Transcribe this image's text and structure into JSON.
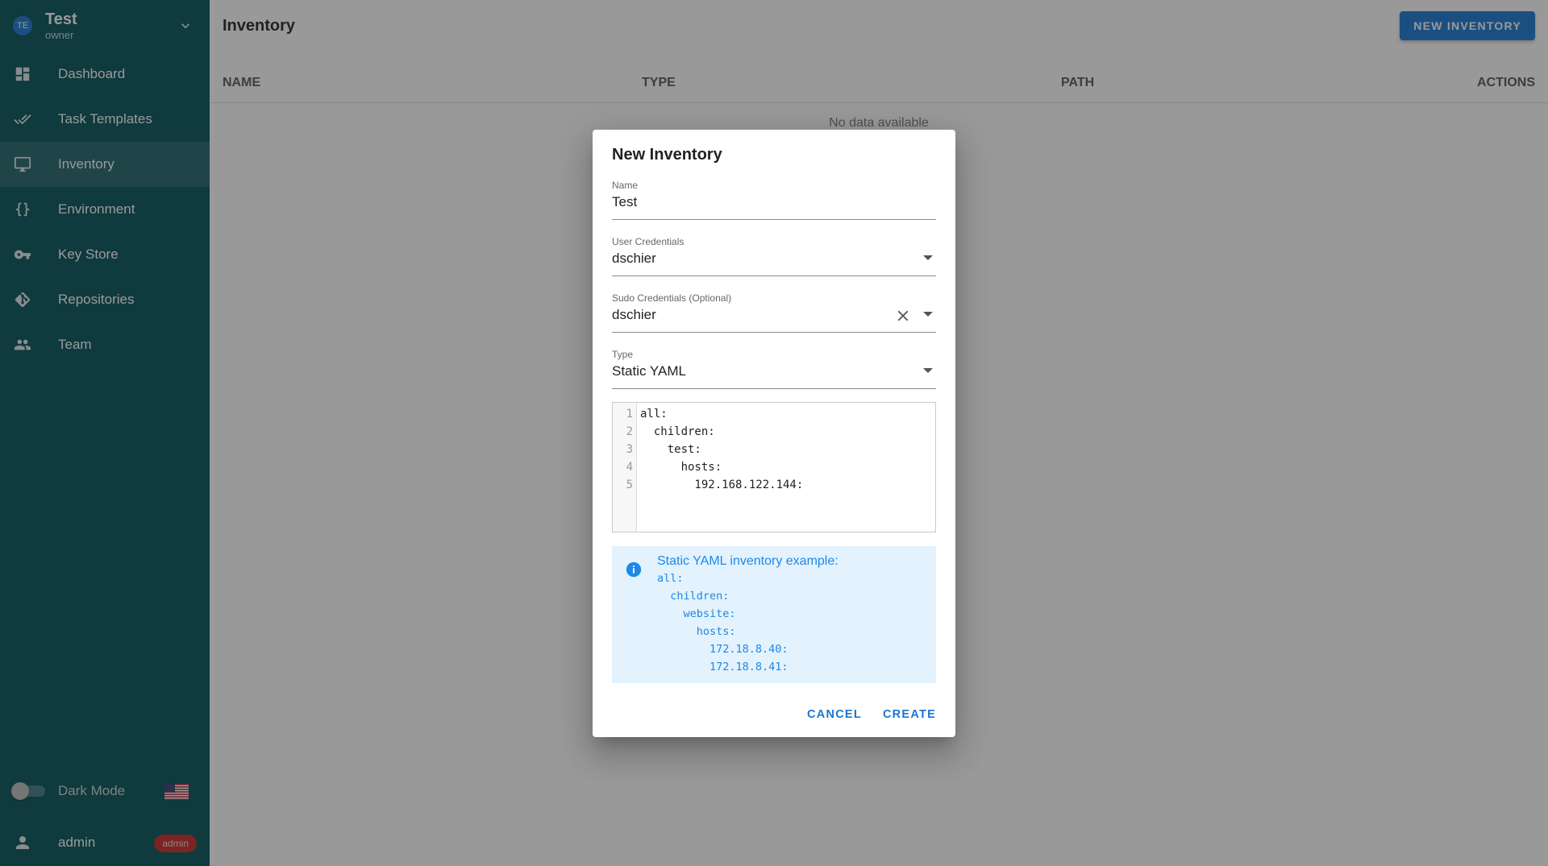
{
  "project": {
    "initials": "TE",
    "name": "Test",
    "role": "owner"
  },
  "nav": {
    "items": [
      {
        "label": "Dashboard",
        "icon": "dashboard-icon"
      },
      {
        "label": "Task Templates",
        "icon": "double-check-icon"
      },
      {
        "label": "Inventory",
        "icon": "monitor-icon",
        "active": true
      },
      {
        "label": "Environment",
        "icon": "curly-braces-icon"
      },
      {
        "label": "Key Store",
        "icon": "key-icon"
      },
      {
        "label": "Repositories",
        "icon": "git-icon"
      },
      {
        "label": "Team",
        "icon": "group-icon"
      }
    ]
  },
  "sidebar_footer": {
    "dark_mode_label": "Dark Mode",
    "dark_mode_on": false,
    "user_name": "admin",
    "user_badge": "admin"
  },
  "page": {
    "title": "Inventory",
    "new_button": "NEW INVENTORY",
    "columns": [
      "NAME",
      "TYPE",
      "PATH",
      "ACTIONS"
    ],
    "empty_text": "No data available"
  },
  "dialog": {
    "title": "New Inventory",
    "name_label": "Name",
    "name_value": "Test",
    "user_cred_label": "User Credentials",
    "user_cred_value": "dschier",
    "sudo_cred_label": "Sudo Credentials (Optional)",
    "sudo_cred_value": "dschier",
    "type_label": "Type",
    "type_value": "Static YAML",
    "code_lines": [
      "all:",
      "  children:",
      "    test:",
      "      hosts:",
      "        192.168.122.144:"
    ],
    "line_numbers": [
      "1",
      "2",
      "3",
      "4",
      "5"
    ],
    "alert_title": "Static YAML inventory example:",
    "alert_lines": [
      "all:",
      "  children:",
      "    website:",
      "      hosts:",
      "        172.18.8.40:",
      "        172.18.8.41:"
    ],
    "cancel_label": "CANCEL",
    "create_label": "CREATE"
  },
  "colors": {
    "sidebar": "#005057",
    "accent": "#1976d2",
    "badge": "#c62828",
    "alert_bg": "#e3f2fd"
  }
}
